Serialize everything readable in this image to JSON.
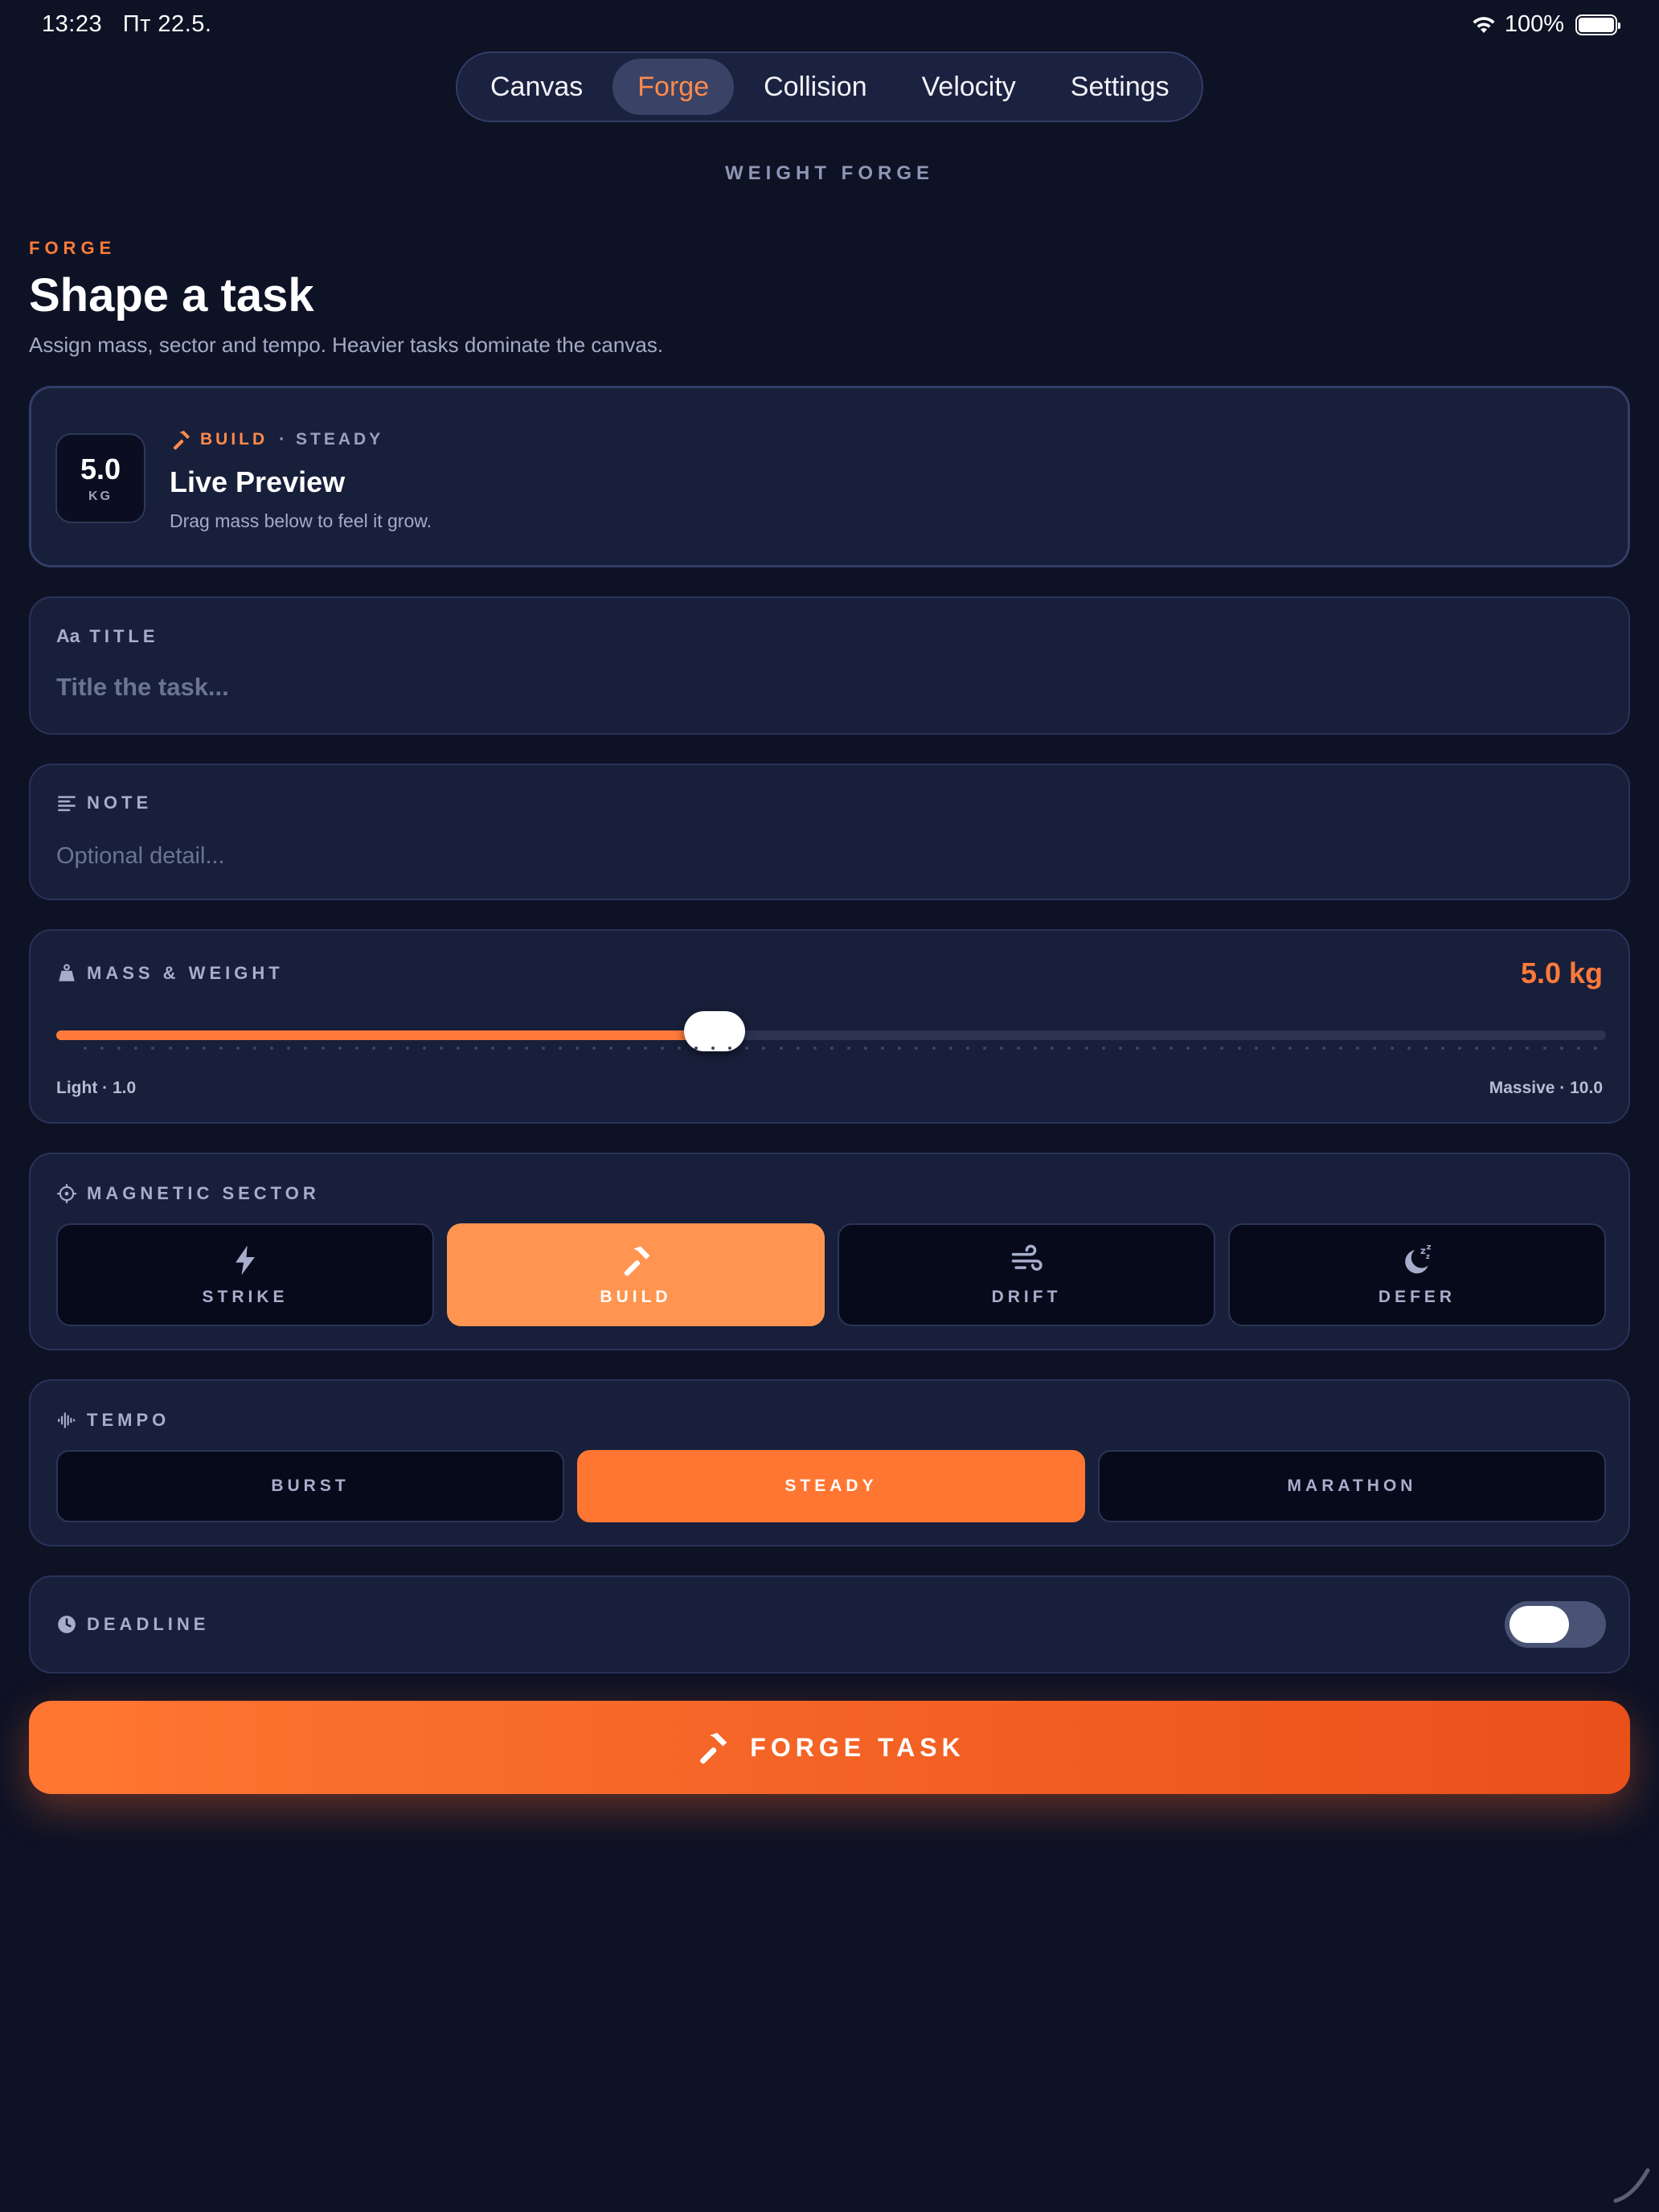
{
  "status_bar": {
    "time": "13:23",
    "date": "Пт 22.5.",
    "battery": "100%"
  },
  "tabs": [
    {
      "label": "Canvas",
      "active": false
    },
    {
      "label": "Forge",
      "active": true
    },
    {
      "label": "Collision",
      "active": false
    },
    {
      "label": "Velocity",
      "active": false
    },
    {
      "label": "Settings",
      "active": false
    }
  ],
  "app_title": "WEIGHT FORGE",
  "header": {
    "eyebrow": "FORGE",
    "title": "Shape a task",
    "subtitle": "Assign mass, sector and tempo. Heavier tasks dominate the canvas."
  },
  "preview": {
    "mass": "5.0",
    "unit": "KG",
    "sector": "BUILD",
    "tempo": "· STEADY",
    "title": "Live Preview",
    "description": "Drag mass below to feel it grow."
  },
  "title_field": {
    "icon_text": "Aa",
    "label": "TITLE",
    "value": "",
    "placeholder": "Title the task..."
  },
  "note_field": {
    "label": "NOTE",
    "value": "",
    "placeholder": "Optional detail..."
  },
  "mass": {
    "label": "MASS & WEIGHT",
    "value_text": "5.0 kg",
    "value": 5.0,
    "min": 1.0,
    "max": 10.0,
    "min_label": "Light · 1.0",
    "max_label": "Massive · 10.0"
  },
  "sector": {
    "label": "MAGNETIC SECTOR",
    "options": [
      {
        "label": "STRIKE",
        "icon": "bolt-icon",
        "active": false
      },
      {
        "label": "BUILD",
        "icon": "hammer-icon",
        "active": true
      },
      {
        "label": "DRIFT",
        "icon": "wind-icon",
        "active": false
      },
      {
        "label": "DEFER",
        "icon": "moon-zzz-icon",
        "active": false
      }
    ]
  },
  "tempo": {
    "label": "TEMPO",
    "options": [
      {
        "label": "BURST",
        "active": false
      },
      {
        "label": "STEADY",
        "active": true
      },
      {
        "label": "MARATHON",
        "active": false
      }
    ]
  },
  "deadline": {
    "label": "DEADLINE",
    "enabled": false
  },
  "forge_button": {
    "label": "FORGE TASK"
  },
  "colors": {
    "background": "#0e1225",
    "card": "#181f3a",
    "accent": "#ff7a3a",
    "accent_light": "#ff9550",
    "muted": "#a7aecb"
  }
}
